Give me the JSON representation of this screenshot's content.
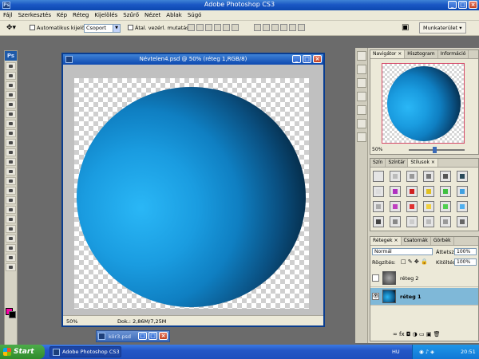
{
  "app": {
    "title": "Adobe Photoshop CS3",
    "icon_label": "Ps"
  },
  "menu": [
    "Fájl",
    "Szerkesztés",
    "Kép",
    "Réteg",
    "Kijelölés",
    "Szűrő",
    "Nézet",
    "Ablak",
    "Súgó"
  ],
  "options": {
    "auto_select_label": "Automatikus kijelölés:",
    "auto_select_value": "Csoport",
    "transform_label": "Átal. vezérl. mutatása",
    "workspace_label": "Munkaterület"
  },
  "document": {
    "title": "Névtelen4.psd @ 50% (réteg 1,RGB/8)",
    "zoom": "50%",
    "doc_info": "Dok.: 2,86M/7,25M"
  },
  "panels": {
    "navigator": {
      "tabs": [
        "Navigátor ×",
        "Hisztogram",
        "Információ"
      ],
      "zoom": "50%"
    },
    "styles": {
      "tabs": [
        "Szín",
        "Színtár",
        "Stílusok ×"
      ]
    },
    "layers": {
      "tabs": [
        "Rétegek ×",
        "Csatornák",
        "Görbék"
      ],
      "blend_mode": "Normál",
      "opacity_label": "Áttetsz.:",
      "opacity_value": "100%",
      "lock_label": "Rögzítés:",
      "fill_label": "Kitöltés:",
      "fill_value": "100%",
      "items": [
        {
          "name": "réteg 2"
        },
        {
          "name": "réteg 1"
        }
      ]
    }
  },
  "minimized_doc": {
    "label": "kör3.psd"
  },
  "taskbar": {
    "start_label": "Start",
    "task_label": "Adobe Photoshop CS3",
    "lang": "HU",
    "clock": "20:51"
  },
  "colors": {
    "foreground": "#ff00aa",
    "background": "#000000",
    "accent": "#0c48b0"
  }
}
